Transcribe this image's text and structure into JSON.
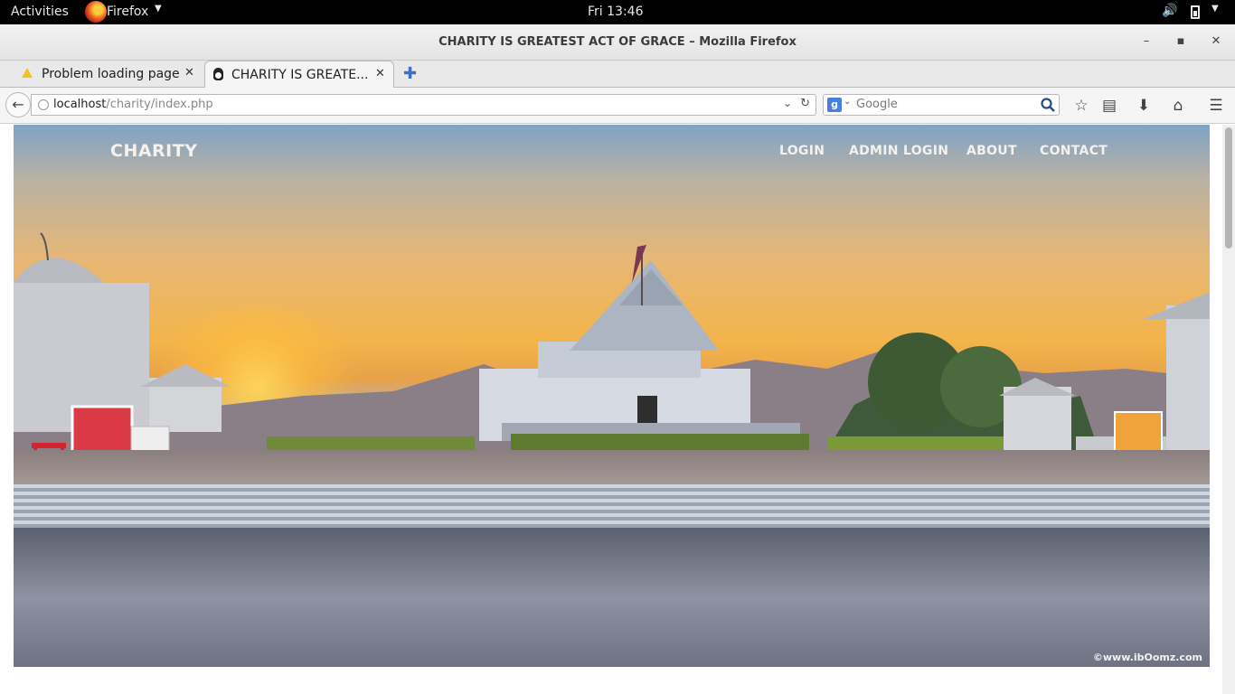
{
  "system_bar": {
    "activities": "Activities",
    "app_name": "Firefox",
    "clock": "Fri 13:46"
  },
  "window": {
    "title": "CHARITY IS GREATEST ACT OF GRACE – Mozilla Firefox"
  },
  "tabs": [
    {
      "label": "Problem loading page",
      "icon": "warning-icon",
      "active": false
    },
    {
      "label": "CHARITY IS GREATE...",
      "icon": "tux-icon",
      "active": true
    }
  ],
  "navbar": {
    "url_host": "localhost",
    "url_path": "/charity/index.php",
    "search_placeholder": "Google"
  },
  "page": {
    "brand": "CHARITY",
    "nav_links": [
      "LOGIN",
      "ADMIN LOGIN",
      "ABOUT",
      "CONTACT"
    ],
    "watermark": "©www.ibOomz.com",
    "hero_image": "temple at sunset with steps and plaza"
  },
  "colors": {
    "topbar": "#000000",
    "nav_text": "#f4f1ee",
    "sky_sunset": "#f3b44a"
  }
}
